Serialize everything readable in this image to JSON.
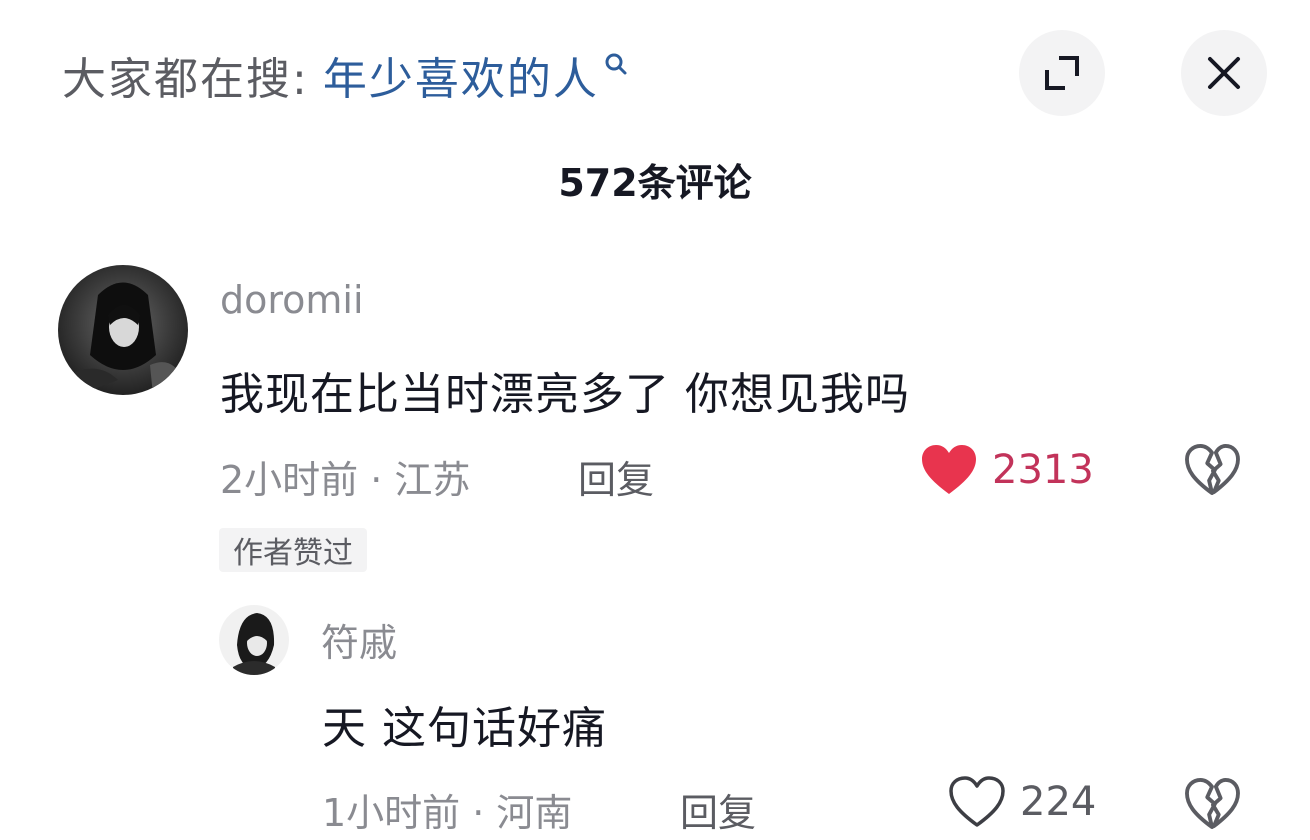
{
  "search_hint": {
    "prefix": "大家都在搜:",
    "term": "年少喜欢的人"
  },
  "header": {
    "title": "572条评论"
  },
  "comments": [
    {
      "username": "doromii",
      "text": "我现在比当时漂亮多了 你想见我吗",
      "meta": "2小时前 · 江苏",
      "reply_label": "回复",
      "likes": "2313",
      "liked": true,
      "badge": "作者赞过"
    }
  ],
  "replies": [
    {
      "username": "符戚",
      "text": "天 这句话好痛",
      "meta": "1小时前 · 河南",
      "reply_label": "回复",
      "likes": "224",
      "liked": false
    }
  ],
  "colors": {
    "accent_link": "#2d5d9b",
    "like_red": "#e8344e",
    "like_count_red": "#c2335a",
    "text_primary": "#161823",
    "text_secondary": "#8a8b91"
  },
  "icons": {
    "search": "search-icon",
    "expand": "expand-icon",
    "close": "close-icon",
    "like_filled": "heart-filled-icon",
    "like_outline": "heart-outline-icon",
    "dislike": "broken-heart-icon"
  }
}
